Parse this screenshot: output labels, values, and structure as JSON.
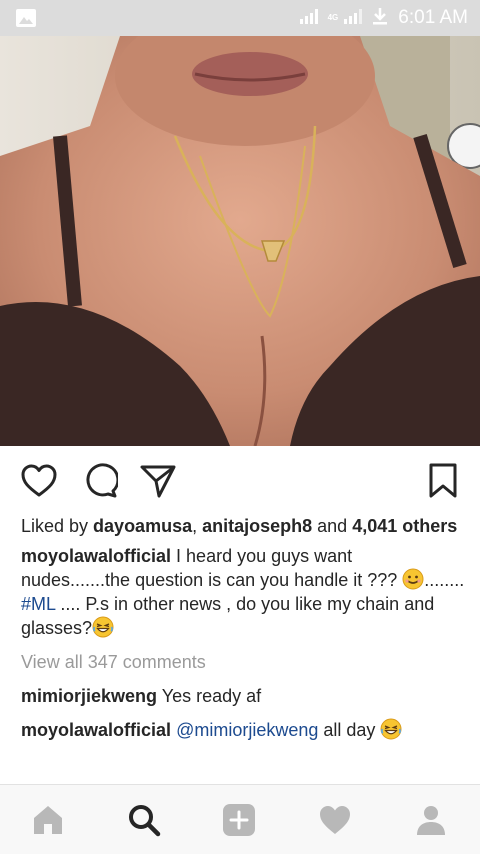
{
  "status_bar": {
    "time": "6:01 AM",
    "network": "4G",
    "icons": [
      "gallery-icon",
      "signal-icon",
      "download-icon"
    ]
  },
  "post": {
    "photo_icon": "photo",
    "likes": {
      "prefix": "Liked by ",
      "user1": "dayoamusa",
      "separator": ", ",
      "user2": "anitajoseph8",
      "and_text": " and ",
      "others_count": "4,041",
      "others_word": "others"
    },
    "caption": {
      "username": "moyolawalofficial",
      "text_part1": " I heard you guys want nudes.......the question is can you handle it ??? ",
      "text_part2": "........ ",
      "hashtag": "#ML",
      "text_part3": " .... P.s in other news , do you like my chain and glasses?"
    },
    "view_all_comments": "View all 347 comments",
    "comments": [
      {
        "username": "mimiorjiekweng",
        "text": " Yes  ready af"
      },
      {
        "username": "moyolawalofficial",
        "mention": "@mimiorjiekweng",
        "text": " all day "
      }
    ]
  },
  "actions": {
    "icons": [
      "heart-icon",
      "comment-icon",
      "share-icon",
      "bookmark-icon"
    ]
  },
  "bottom_nav": {
    "items": [
      "home-icon",
      "search-icon",
      "add-icon",
      "heart-icon",
      "profile-icon"
    ]
  },
  "colors": {
    "link": "#1c4a8f",
    "muted": "#9a9a9a",
    "text": "#262626",
    "status_bar": "#dcdcdc"
  }
}
